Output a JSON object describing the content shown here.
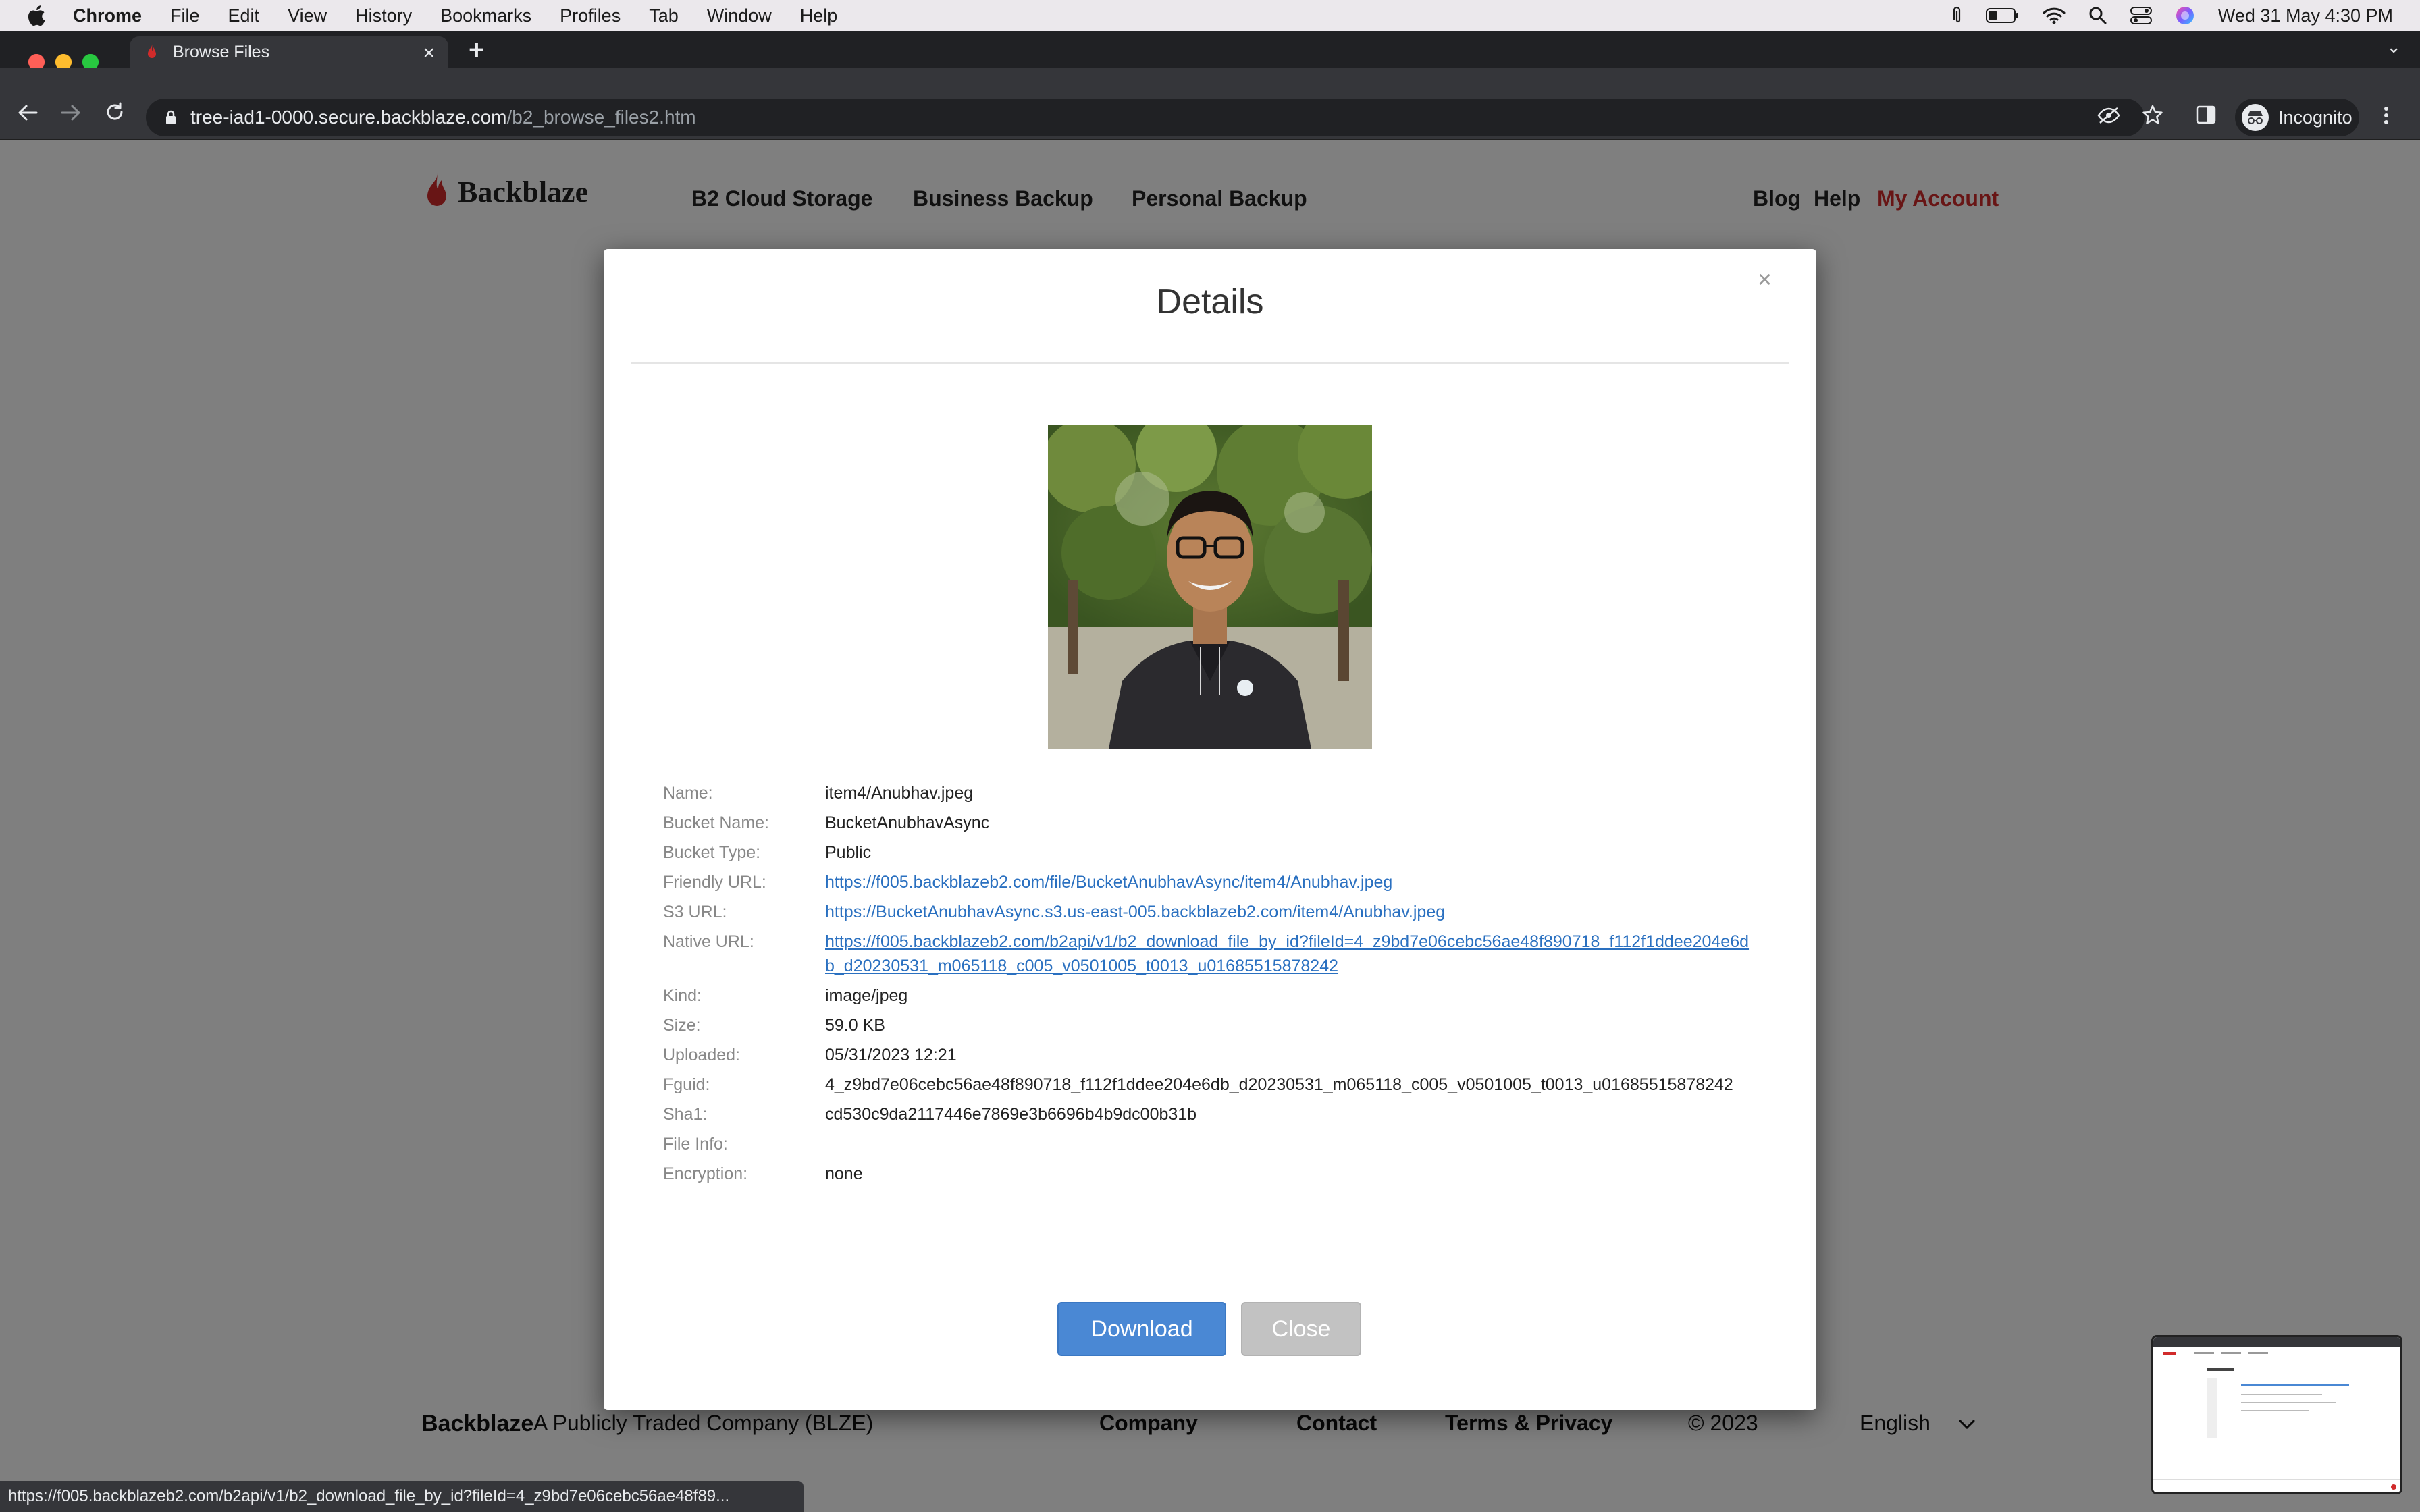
{
  "menubar": {
    "app": "Chrome",
    "items": [
      "File",
      "Edit",
      "View",
      "History",
      "Bookmarks",
      "Profiles",
      "Tab",
      "Window",
      "Help"
    ],
    "datetime": "Wed 31 May  4:30 PM"
  },
  "browser": {
    "tab_title": "Browse Files",
    "url_host": "tree-iad1-0000.secure.backblaze.com",
    "url_path": "/b2_browse_files2.htm",
    "profile_label": "Incognito"
  },
  "site": {
    "brand": "Backblaze",
    "nav": [
      "B2 Cloud Storage",
      "Business Backup",
      "Personal Backup"
    ],
    "nav_right": [
      "Blog",
      "Help",
      "My Account"
    ],
    "footer": {
      "brand": "Backblaze",
      "tagline": "A Publicly Traded Company (BLZE)",
      "links": [
        "Company",
        "Contact",
        "Terms & Privacy"
      ],
      "copyright": "© 2023",
      "language": "English"
    }
  },
  "modal": {
    "title": "Details",
    "close_symbol": "×",
    "fields": [
      {
        "label": "Name:",
        "value": "item4/Anubhav.jpeg",
        "kind": "text"
      },
      {
        "label": "Bucket Name:",
        "value": "BucketAnubhavAsync",
        "kind": "text"
      },
      {
        "label": "Bucket Type:",
        "value": "Public",
        "kind": "text"
      },
      {
        "label": "Friendly URL:",
        "value": "https://f005.backblazeb2.com/file/BucketAnubhavAsync/item4/Anubhav.jpeg",
        "kind": "link"
      },
      {
        "label": "S3 URL:",
        "value": "https://BucketAnubhavAsync.s3.us-east-005.backblazeb2.com/item4/Anubhav.jpeg",
        "kind": "link"
      },
      {
        "label": "Native URL:",
        "value": "https://f005.backblazeb2.com/b2api/v1/b2_download_file_by_id?fileId=4_z9bd7e06cebc56ae48f890718_f112f1ddee204e6db_d20230531_m065118_c005_v0501005_t0013_u01685515878242",
        "kind": "ulink"
      },
      {
        "label": "Kind:",
        "value": "image/jpeg",
        "kind": "text"
      },
      {
        "label": "Size:",
        "value": "59.0 KB",
        "kind": "text"
      },
      {
        "label": "Uploaded:",
        "value": "05/31/2023 12:21",
        "kind": "text"
      },
      {
        "label": "Fguid:",
        "value": "4_z9bd7e06cebc56ae48f890718_f112f1ddee204e6db_d20230531_m065118_c005_v0501005_t0013_u01685515878242",
        "kind": "text"
      },
      {
        "label": "Sha1:",
        "value": "cd530c9da2117446e7869e3b6696b4b9dc00b31b",
        "kind": "text"
      },
      {
        "label": "File Info:",
        "value": "",
        "kind": "text"
      },
      {
        "label": "Encryption:",
        "value": "none",
        "kind": "text"
      }
    ],
    "download_label": "Download",
    "close_label": "Close"
  },
  "statusbar": {
    "text": "https://f005.backblazeb2.com/b2api/v1/b2_download_file_by_id?fileId=4_z9bd7e06cebc56ae48f89..."
  },
  "colors": {
    "brand_red": "#d12b2b",
    "link_blue": "#2a70c0",
    "primary_button": "#4a88d4",
    "secondary_button": "#c2c2c2"
  }
}
